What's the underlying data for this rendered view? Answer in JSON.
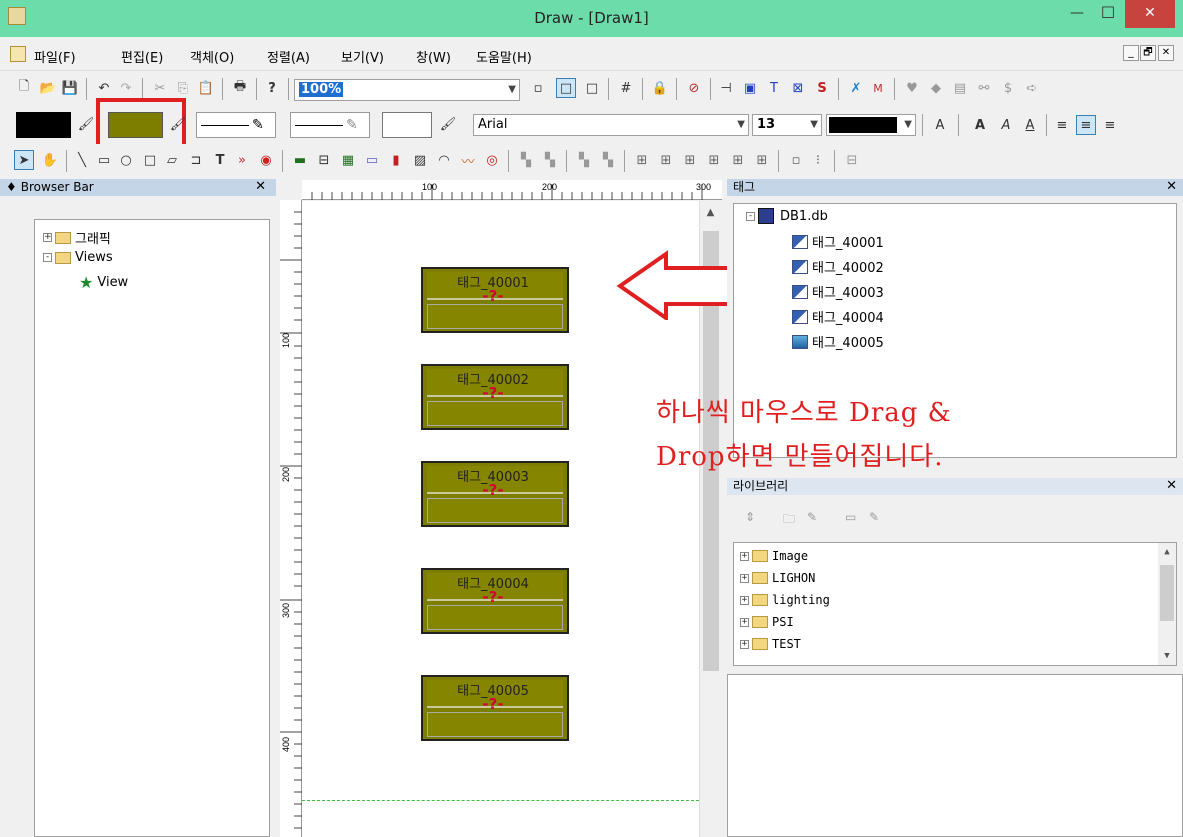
{
  "window": {
    "title": "Draw - [Draw1]",
    "minimize": "—",
    "maximize": "☐",
    "close": "✕"
  },
  "menu": [
    "파일(F)",
    "편집(E)",
    "객체(O)",
    "정렬(A)",
    "보기(V)",
    "창(W)",
    "도움말(H)"
  ],
  "mdi_controls": [
    "_",
    "🗗",
    "✕"
  ],
  "toolbar": {
    "zoom_value": "100%",
    "font_value": "Arial",
    "font_size_value": "13"
  },
  "colors": {
    "fill": "#7d7d00",
    "line": "#000000",
    "accent_red": "#e02020",
    "titlebar": "#6cdcaa"
  },
  "browser_bar": {
    "title": "Browser Bar",
    "close": "✕",
    "items": [
      {
        "label": "그래픽",
        "type": "folder",
        "expander": "+"
      },
      {
        "label": "Views",
        "type": "folder",
        "expander": "-"
      },
      {
        "label": "View",
        "type": "view-star"
      }
    ]
  },
  "ruler": {
    "top_ticks": [
      "100",
      "200",
      "300"
    ],
    "left_ticks": [
      "100",
      "200",
      "300",
      "400"
    ]
  },
  "canvas": {
    "tags": [
      {
        "label": "태그_40001",
        "mark": "-?-"
      },
      {
        "label": "태그_40002",
        "mark": "-?-"
      },
      {
        "label": "태그_40003",
        "mark": "-?-"
      },
      {
        "label": "태그_40004",
        "mark": "-?-"
      },
      {
        "label": "태그_40005",
        "mark": "-?-"
      }
    ]
  },
  "tag_panel": {
    "title": "태그",
    "close": "✕",
    "root": "DB1.db",
    "items": [
      "태그_40001",
      "태그_40002",
      "태그_40003",
      "태그_40004",
      "태그_40005"
    ]
  },
  "annotation": {
    "line1": "하나씩 마우스로 Drag &",
    "line2": "Drop하면 만들어집니다."
  },
  "library_panel": {
    "title": "라이브러리",
    "close": "✕",
    "items": [
      "Image",
      "LIGHON",
      "lighting",
      "PSI",
      "TEST"
    ]
  }
}
